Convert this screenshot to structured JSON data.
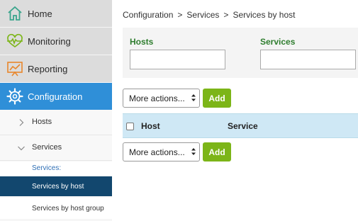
{
  "sidebar": {
    "home": "Home",
    "monitoring": "Monitoring",
    "reporting": "Reporting",
    "configuration": "Configuration",
    "sub": {
      "hosts": "Hosts",
      "services": "Services",
      "services_section": "Services:",
      "services_by_host": "Services by host",
      "services_by_host_group": "Services by host group"
    }
  },
  "breadcrumb": {
    "items": [
      "Configuration",
      "Services",
      "Services by host"
    ],
    "separator": ">"
  },
  "filters": {
    "hosts_label": "Hosts",
    "hosts_value": "",
    "services_label": "Services",
    "services_value": ""
  },
  "actions": {
    "more_actions": "More actions...",
    "add": "Add"
  },
  "table": {
    "columns": [
      "Host",
      "Service"
    ]
  },
  "colors": {
    "active_nav": "#2f8fd8",
    "selected_item": "#12476e",
    "add_button": "#7cb518",
    "table_header": "#cfe8f5"
  }
}
